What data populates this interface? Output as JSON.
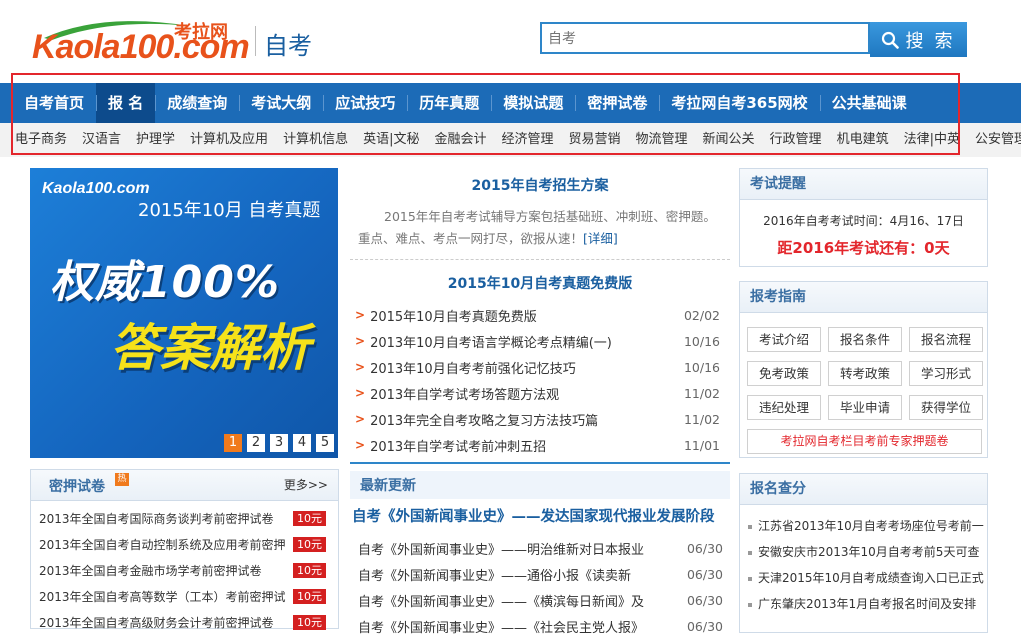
{
  "header": {
    "logo_text_en": "Kaola100.com",
    "logo_text_cn": "考拉网",
    "site_name": "自考",
    "search": {
      "placeholder": "自考",
      "button_label": "搜 索"
    }
  },
  "nav": {
    "items": [
      {
        "label": "自考首页",
        "active": false
      },
      {
        "label": "报 名",
        "active": true
      },
      {
        "label": "成绩查询",
        "active": false
      },
      {
        "label": "考试大纲",
        "active": false
      },
      {
        "label": "应试技巧",
        "active": false
      },
      {
        "label": "历年真题",
        "active": false
      },
      {
        "label": "模拟试题",
        "active": false
      },
      {
        "label": "密押试卷",
        "active": false
      },
      {
        "label": "考拉网自考365网校",
        "active": false
      },
      {
        "label": "公共基础课",
        "active": false
      }
    ],
    "sub_items": [
      "电子商务",
      "汉语言",
      "护理学",
      "计算机及应用",
      "计算机信息",
      "英语|文秘",
      "金融会计",
      "经济管理",
      "贸易营销",
      "物流管理",
      "新闻公关",
      "行政管理",
      "机电建筑",
      "法律|中英",
      "公安管理"
    ]
  },
  "banner": {
    "logo": "Kaola100.com",
    "title": "2015年10月 自考真题",
    "line1": "权威100%",
    "line2": "答案解析",
    "pages": [
      "1",
      "2",
      "3",
      "4",
      "5"
    ],
    "active_page": 1
  },
  "center": {
    "headline1": "2015年自考招生方案",
    "description": "2015年年自考考试辅导方案包括基础班、冲刺班、密押题。重点、难点、考点一网打尽，欲报从速！",
    "description_more": "[详细]",
    "headline2": "2015年10月自考真题免费版",
    "news": [
      {
        "title": "2015年10月自考真题免费版",
        "date": "02/02"
      },
      {
        "title": "2013年10月自考语言学概论考点精编(一)",
        "date": "10/16"
      },
      {
        "title": "2013年10月自考考前强化记忆技巧",
        "date": "10/16"
      },
      {
        "title": "2013年自学考试考场答题方法观",
        "date": "11/02"
      },
      {
        "title": "2013年完全自考攻略之复习方法技巧篇",
        "date": "11/02"
      },
      {
        "title": "2013年自学考试考前冲刺五招",
        "date": "11/01"
      }
    ]
  },
  "reminder": {
    "title": "考试提醒",
    "exam_time": "2016年自考考试时间：4月16、17日",
    "countdown": "距2016年考试还有：0天"
  },
  "guide": {
    "title": "报考指南",
    "buttons": [
      "考试介绍",
      "报名条件",
      "报名流程",
      "免考政策",
      "转考政策",
      "学习形式",
      "违纪处理",
      "毕业申请",
      "获得学位"
    ],
    "banner_link": "考拉网自考栏目考前专家押题卷"
  },
  "query": {
    "title": "报名查分",
    "items": [
      "江苏省2013年10月自考考场座位号考前一",
      "安徽安庆市2013年10月自考考前5天可查",
      "天津2015年10月自考成绩查询入口已正式",
      "广东肇庆2013年1月自考报名时间及安排"
    ]
  },
  "papers": {
    "title": "密押试卷",
    "hot": "热",
    "more": "更多>>",
    "items": [
      {
        "title": "2013年全国自考国际商务谈判考前密押试卷",
        "price": "10元"
      },
      {
        "title": "2013年全国自考自动控制系统及应用考前密押",
        "price": "10元"
      },
      {
        "title": "2013年全国自考金融市场学考前密押试卷",
        "price": "10元"
      },
      {
        "title": "2013年全国自考高等数学（工本）考前密押试",
        "price": "10元"
      },
      {
        "title": "2013年全国自考高级财务会计考前密押试卷",
        "price": "10元"
      }
    ]
  },
  "latest": {
    "title": "最新更新",
    "feature": "自考《外国新闻事业史》——发达国家现代报业发展阶段",
    "items": [
      {
        "title": "自考《外国新闻事业史》——明治维新对日本报业",
        "date": "06/30"
      },
      {
        "title": "自考《外国新闻事业史》——通俗小报《读卖新",
        "date": "06/30"
      },
      {
        "title": "自考《外国新闻事业史》——《横滨每日新闻》及",
        "date": "06/30"
      },
      {
        "title": "自考《外国新闻事业史》——《社会民主党人报》",
        "date": "06/30"
      }
    ]
  },
  "colors": {
    "nav_blue": "#1c6bb7",
    "nav_active": "#0d4b8c",
    "accent_orange": "#e8521b",
    "highlight_red": "#e3262c",
    "link_blue": "#1a5fa0"
  }
}
